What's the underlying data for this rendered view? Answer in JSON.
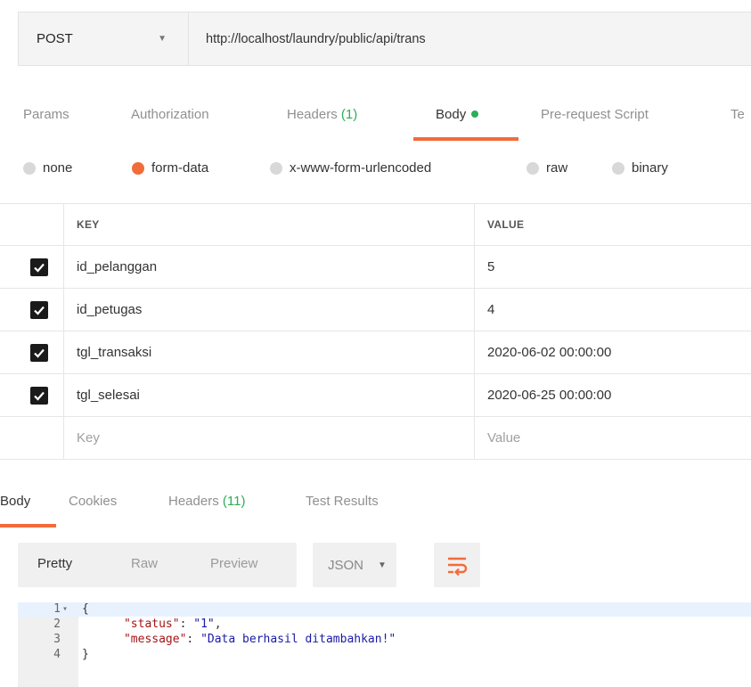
{
  "request": {
    "method": "POST",
    "url": "http://localhost/laundry/public/api/trans"
  },
  "request_tabs": [
    {
      "label": "Params"
    },
    {
      "label": "Authorization"
    },
    {
      "label": "Headers",
      "count": "(1)"
    },
    {
      "label": "Body"
    },
    {
      "label": "Pre-request Script"
    },
    {
      "label": "Te"
    }
  ],
  "body_types": [
    {
      "label": "none",
      "selected": false
    },
    {
      "label": "form-data",
      "selected": true
    },
    {
      "label": "x-www-form-urlencoded",
      "selected": false
    },
    {
      "label": "raw",
      "selected": false
    },
    {
      "label": "binary",
      "selected": false
    }
  ],
  "table": {
    "headers": {
      "key": "KEY",
      "value": "VALUE"
    },
    "rows": [
      {
        "key": "id_pelanggan",
        "value": "5",
        "checked": true
      },
      {
        "key": "id_petugas",
        "value": "4",
        "checked": true
      },
      {
        "key": "tgl_transaksi",
        "value": "2020-06-02 00:00:00",
        "checked": true
      },
      {
        "key": "tgl_selesai",
        "value": "2020-06-25 00:00:00",
        "checked": true
      }
    ],
    "placeholder": {
      "key": "Key",
      "value": "Value"
    }
  },
  "response_tabs": [
    {
      "label": "Body"
    },
    {
      "label": "Cookies"
    },
    {
      "label": "Headers",
      "count": "(11)"
    },
    {
      "label": "Test Results"
    }
  ],
  "response_toolbar": {
    "modes": [
      "Pretty",
      "Raw",
      "Preview"
    ],
    "format": "JSON"
  },
  "response_body": {
    "line_numbers": [
      "1",
      "2",
      "3",
      "4"
    ],
    "open_brace": "{",
    "close_brace": "}",
    "fields": [
      {
        "key": "\"status\"",
        "value": "\"1\"",
        "trail": ","
      },
      {
        "key": "\"message\"",
        "value": "\"Data berhasil ditambahkan!\"",
        "trail": ""
      }
    ]
  },
  "colors": {
    "accent": "#f26b3a",
    "count_green": "#2dad58",
    "json_key": "#a31515",
    "json_string": "#1a1aa6"
  }
}
